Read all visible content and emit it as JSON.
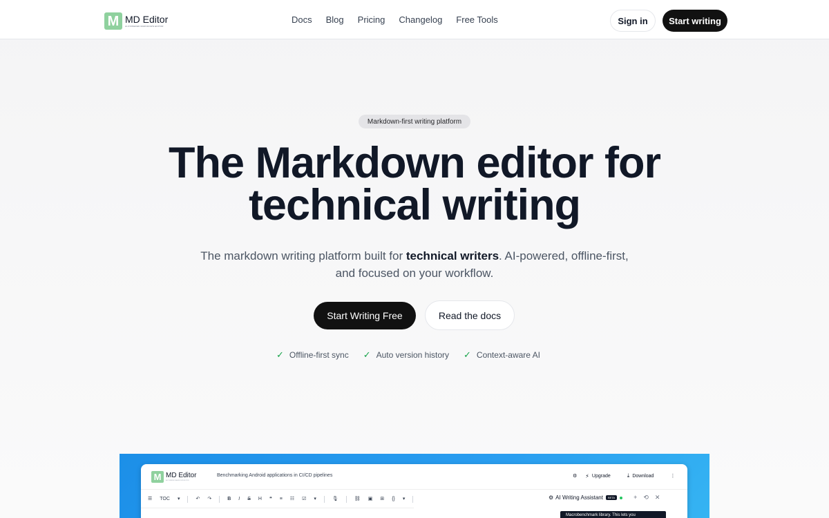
{
  "nav": {
    "logo": {
      "name": "MD Editor",
      "tagline": "AI-POWERED MARKDOWN EDITOR"
    },
    "links": [
      "Docs",
      "Blog",
      "Pricing",
      "Changelog",
      "Free Tools"
    ],
    "sign_in": "Sign in",
    "start_writing": "Start writing"
  },
  "hero": {
    "pill": "Markdown-first writing platform",
    "title_line1": "The Markdown editor for",
    "title_line2": "technical writing",
    "subtitle_prefix": "The markdown writing platform built for ",
    "subtitle_bold": "technical writers",
    "subtitle_suffix": ". AI-powered, offline-first,",
    "subtitle_line2": "and focused on your workflow.",
    "cta_primary": "Start Writing Free",
    "cta_secondary": "Read the docs",
    "features": [
      "Offline-first sync",
      "Auto version history",
      "Context-aware AI"
    ]
  },
  "preview": {
    "app_logo": {
      "name": "MD Editor",
      "tagline": "AI-POWERED MARKDOWN EDITOR"
    },
    "doc_title": "Benchmarking Android applications in CI/CD pipelines",
    "actions": {
      "upgrade": "Upgrade",
      "download": "Download"
    },
    "toolbar": {
      "toc": "TOC"
    },
    "ai_panel": {
      "title": "AI Writing Assistant",
      "badge": "BETA",
      "message": "Macrobenchmark library. This lets you"
    }
  },
  "colors": {
    "accent_dark": "#111111",
    "logo_green": "#8fd19e",
    "check_green": "#16a34a",
    "preview_blue": "#1c8fe8"
  }
}
